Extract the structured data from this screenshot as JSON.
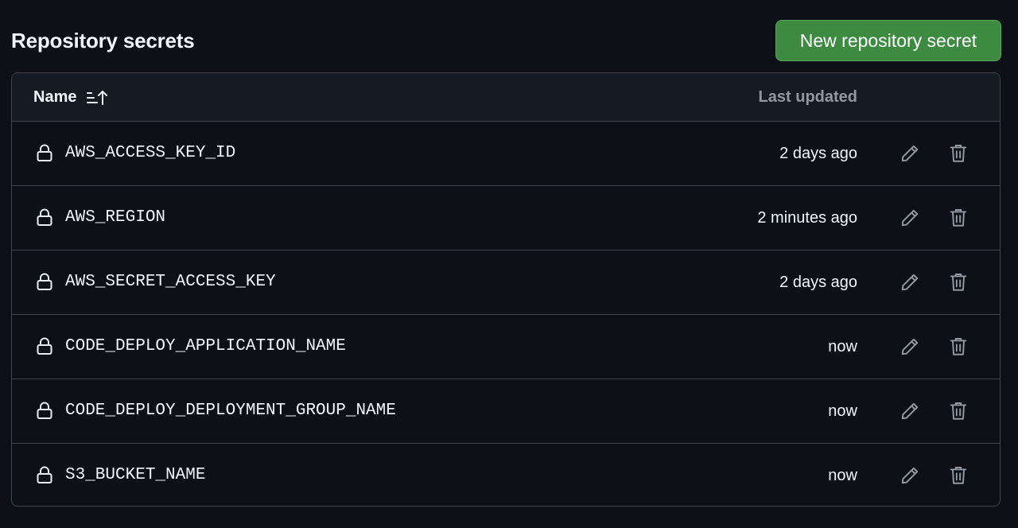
{
  "header": {
    "title": "Repository secrets",
    "new_button_label": "New repository secret"
  },
  "table": {
    "columns": {
      "name": "Name",
      "last_updated": "Last updated"
    },
    "sort_icon": "sort-ascending-icon",
    "rows": [
      {
        "name": "AWS_ACCESS_KEY_ID",
        "updated": "2 days ago"
      },
      {
        "name": "AWS_REGION",
        "updated": "2 minutes ago"
      },
      {
        "name": "AWS_SECRET_ACCESS_KEY",
        "updated": "2 days ago"
      },
      {
        "name": "CODE_DEPLOY_APPLICATION_NAME",
        "updated": "now"
      },
      {
        "name": "CODE_DEPLOY_DEPLOYMENT_GROUP_NAME",
        "updated": "now"
      },
      {
        "name": "S3_BUCKET_NAME",
        "updated": "now"
      }
    ],
    "row_icons": {
      "leading": "lock-icon",
      "edit": "pencil-icon",
      "delete": "trash-icon"
    }
  },
  "colors": {
    "background": "#0d1117",
    "header_background": "#151b23",
    "border": "#3d444d",
    "primary_button": "#3c8b40",
    "text": "#f0f6fc",
    "muted_text": "#9198a1"
  }
}
